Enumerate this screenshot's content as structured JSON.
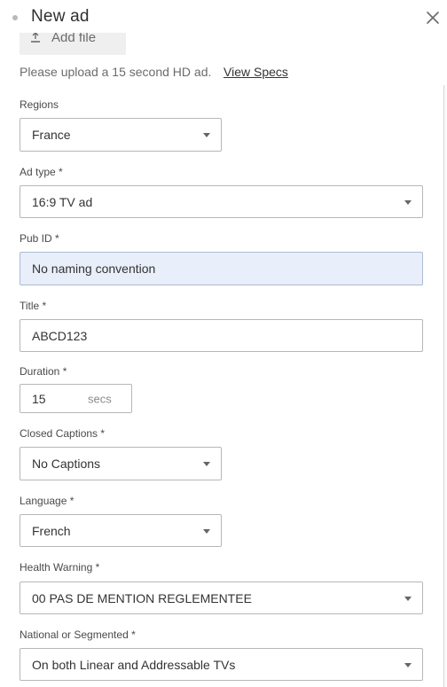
{
  "header": {
    "title": "New ad",
    "close_icon": "close-icon"
  },
  "upload": {
    "add_file_label": "Add file",
    "hint": "Please upload a 15 second HD ad.",
    "specs_link": "View Specs"
  },
  "fields": {
    "regions": {
      "label": "Regions",
      "value": "France"
    },
    "ad_type": {
      "label": "Ad type *",
      "value": "16:9 TV ad"
    },
    "pub_id": {
      "label": "Pub ID *",
      "value": "No naming convention"
    },
    "title": {
      "label": "Title *",
      "value": "ABCD123"
    },
    "duration": {
      "label": "Duration *",
      "value": "15",
      "unit": "secs"
    },
    "closed_captions": {
      "label": "Closed Captions *",
      "value": "No Captions"
    },
    "language": {
      "label": "Language *",
      "value": "French"
    },
    "health_warning": {
      "label": "Health Warning *",
      "value": "00 PAS DE MENTION REGLEMENTEE"
    },
    "national_segmented": {
      "label": "National or Segmented *",
      "value": "On both Linear and Addressable TVs"
    }
  },
  "colors": {
    "readonly_bg": "#e8eefa",
    "border": "#b7b7b7",
    "text": "#333333"
  }
}
